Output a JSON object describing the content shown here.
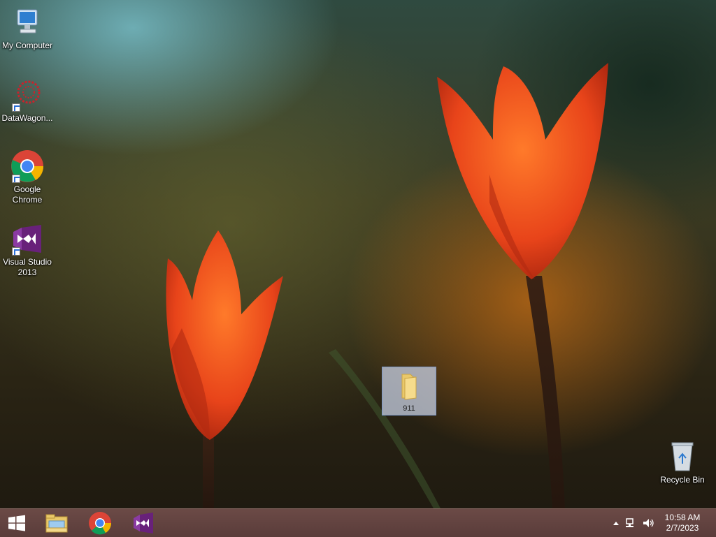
{
  "desktop_icons": [
    {
      "name": "my-computer",
      "label": "My Computer",
      "icon": "computer-icon"
    },
    {
      "name": "datawagon",
      "label": "DataWagon...",
      "icon": "datawagon-icon"
    },
    {
      "name": "google-chrome",
      "label": "Google Chrome",
      "icon": "chrome-icon"
    },
    {
      "name": "visual-studio",
      "label": "Visual Studio 2013",
      "icon": "visual-studio-icon"
    },
    {
      "name": "folder-911",
      "label": "911",
      "icon": "folder-icon",
      "selected": true
    },
    {
      "name": "recycle-bin",
      "label": "Recycle Bin",
      "icon": "recycle-bin-icon"
    }
  ],
  "taskbar": {
    "start_icon": "windows-logo-icon",
    "pinned": [
      {
        "name": "file-explorer",
        "icon": "file-explorer-icon"
      },
      {
        "name": "chrome",
        "icon": "chrome-icon"
      },
      {
        "name": "visual-studio",
        "icon": "visual-studio-icon"
      }
    ],
    "tray": {
      "icons": [
        "chevron-up-icon",
        "network-icon",
        "speaker-icon"
      ],
      "time": "10:58 AM",
      "date": "2/7/2023"
    }
  },
  "colors": {
    "taskbar": "#5e403d",
    "tulip": "#e8471a",
    "selection": "#c8d2e6"
  }
}
